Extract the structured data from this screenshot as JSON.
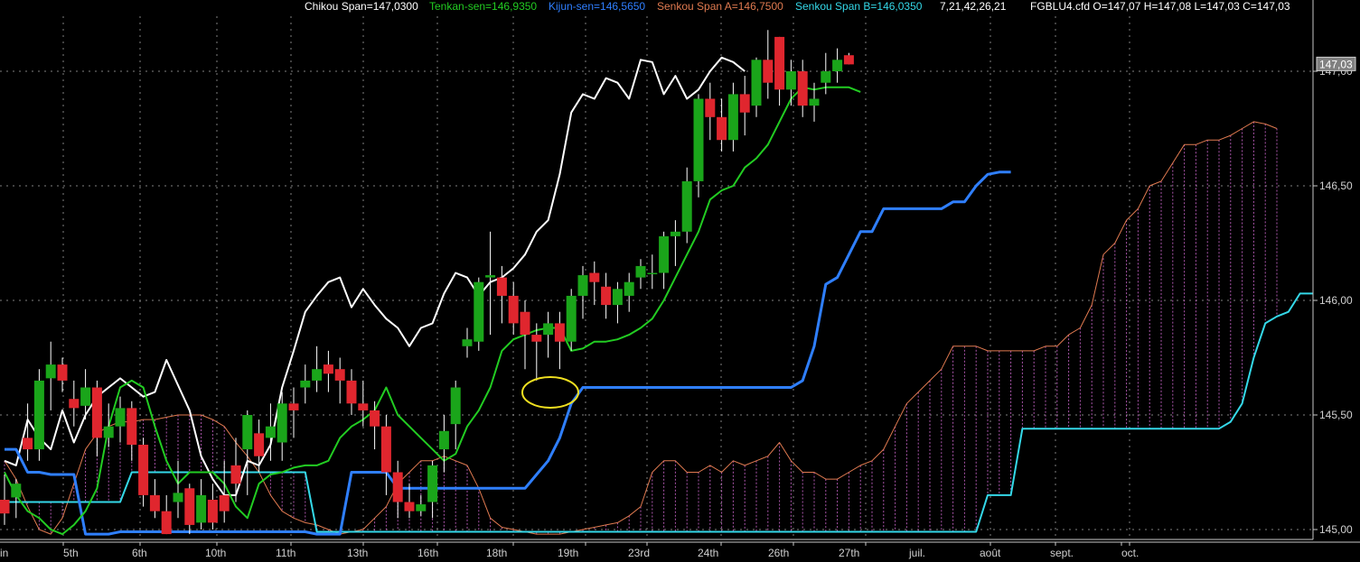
{
  "header": {
    "chikou": "Chikou Span=147,0300",
    "tenkan": "Tenkan-sen=146,9350",
    "kijun": "Kijun-sen=146,5650",
    "senkou_a": "Senkou Span A=146,7500",
    "senkou_b": "Senkou Span B=146,0350",
    "params": "7,21,42,26,21",
    "ohlc": "FGBLU4.cfd O=147,07 H=147,08 L=147,03 C=147,03"
  },
  "colors": {
    "background": "#000000",
    "grid": "#808080",
    "up_candle": "#1aa51a",
    "down_candle": "#e0262e",
    "wick": "#ffffff",
    "chikou": "#ffffff",
    "tenkan": "#22cc22",
    "kijun": "#2f7fff",
    "senkou_a": "#e07a50",
    "senkou_b": "#34d8e8",
    "cloud_fill": "#cc66cc",
    "highlight_ellipse": "#f0e020"
  },
  "current_price_label": "147,03",
  "chart_data": {
    "type": "line",
    "subtype": "ichimoku candlestick",
    "yticks": [
      "145,00",
      "145,50",
      "146,00",
      "146,50",
      "147,00"
    ],
    "ylim": [
      144.98,
      147.2
    ],
    "xticks": [
      "in",
      "5th",
      "6th",
      "10th",
      "11th",
      "13th",
      "16th",
      "18th",
      "19th",
      "23rd",
      "24th",
      "26th",
      "27th",
      "juil.",
      "août",
      "sept.",
      "oct."
    ],
    "grid": true,
    "annotation": "ellipse at Kijun-sen near 145,62",
    "candles": [
      [
        145.13,
        145.07,
        145.24,
        145.02
      ],
      [
        145.14,
        145.2,
        145.22,
        145.05
      ],
      [
        145.4,
        145.35,
        145.55,
        145.3
      ],
      [
        145.35,
        145.65,
        145.7,
        145.3
      ],
      [
        145.66,
        145.72,
        145.82,
        145.52
      ],
      [
        145.72,
        145.65,
        145.75,
        145.6
      ],
      [
        145.57,
        145.53,
        145.65,
        145.45
      ],
      [
        145.54,
        145.62,
        145.7,
        145.48
      ],
      [
        145.62,
        145.4,
        145.65,
        145.32
      ],
      [
        145.4,
        145.45,
        145.55,
        145.36
      ],
      [
        145.45,
        145.53,
        145.58,
        145.38
      ],
      [
        145.53,
        145.37,
        145.56,
        145.3
      ],
      [
        145.37,
        145.15,
        145.4,
        145.1
      ],
      [
        145.15,
        145.08,
        145.22,
        145.05
      ],
      [
        145.08,
        144.98,
        145.15,
        144.98
      ],
      [
        145.12,
        145.16,
        145.3,
        145.05
      ],
      [
        145.18,
        145.02,
        145.2,
        144.98
      ],
      [
        145.03,
        145.15,
        145.22,
        145.0
      ],
      [
        145.13,
        145.03,
        145.2,
        145.0
      ],
      [
        145.15,
        145.08,
        145.3,
        145.03
      ],
      [
        145.28,
        145.2,
        145.4,
        145.12
      ],
      [
        145.35,
        145.5,
        145.52,
        145.15
      ],
      [
        145.42,
        145.32,
        145.48,
        145.25
      ],
      [
        145.4,
        145.45,
        145.55,
        145.3
      ],
      [
        145.38,
        145.55,
        145.6,
        145.3
      ],
      [
        145.55,
        145.52,
        145.62,
        145.4
      ],
      [
        145.62,
        145.65,
        145.72,
        145.55
      ],
      [
        145.65,
        145.7,
        145.8,
        145.6
      ],
      [
        145.72,
        145.68,
        145.78,
        145.6
      ],
      [
        145.7,
        145.65,
        145.75,
        145.55
      ],
      [
        145.65,
        145.55,
        145.7,
        145.5
      ],
      [
        145.55,
        145.52,
        145.65,
        145.45
      ],
      [
        145.52,
        145.45,
        145.56,
        145.35
      ],
      [
        145.45,
        145.25,
        145.5,
        145.15
      ],
      [
        145.25,
        145.12,
        145.3,
        145.05
      ],
      [
        145.12,
        145.08,
        145.2,
        145.05
      ],
      [
        145.08,
        145.11,
        145.15,
        145.06
      ],
      [
        145.12,
        145.28,
        145.3,
        145.05
      ],
      [
        145.35,
        145.43,
        145.5,
        145.25
      ],
      [
        145.46,
        145.62,
        145.65,
        145.35
      ],
      [
        145.8,
        145.83,
        145.88,
        145.75
      ],
      [
        145.82,
        146.08,
        146.1,
        145.78
      ],
      [
        146.1,
        146.11,
        146.3,
        145.85
      ],
      [
        146.1,
        146.02,
        146.15,
        145.9
      ],
      [
        146.02,
        145.9,
        146.08,
        145.85
      ],
      [
        145.95,
        145.85,
        146.0,
        145.7
      ],
      [
        145.85,
        145.82,
        145.9,
        145.65
      ],
      [
        145.85,
        145.9,
        145.95,
        145.75
      ],
      [
        145.9,
        145.82,
        145.95,
        145.7
      ],
      [
        145.82,
        146.02,
        146.05,
        145.78
      ],
      [
        146.02,
        146.11,
        146.15,
        145.92
      ],
      [
        146.12,
        146.08,
        146.17,
        145.98
      ],
      [
        146.06,
        145.98,
        146.12,
        145.92
      ],
      [
        145.98,
        146.05,
        146.08,
        145.9
      ],
      [
        146.02,
        146.08,
        146.12,
        145.95
      ],
      [
        146.1,
        146.15,
        146.18,
        146.05
      ],
      [
        146.12,
        146.12,
        146.2,
        146.05
      ],
      [
        146.12,
        146.28,
        146.3,
        146.05
      ],
      [
        146.28,
        146.3,
        146.35,
        146.15
      ],
      [
        146.3,
        146.52,
        146.58,
        146.25
      ],
      [
        146.52,
        146.88,
        146.9,
        146.45
      ],
      [
        146.88,
        146.8,
        146.95,
        146.7
      ],
      [
        146.8,
        146.7,
        146.88,
        146.65
      ],
      [
        146.7,
        146.9,
        146.95,
        146.65
      ],
      [
        146.9,
        146.82,
        146.98,
        146.72
      ],
      [
        146.85,
        147.05,
        147.06,
        146.8
      ],
      [
        147.05,
        146.95,
        147.18,
        146.88
      ],
      [
        147.15,
        146.92,
        147.15,
        146.85
      ],
      [
        146.92,
        147.0,
        147.05,
        146.85
      ],
      [
        147.0,
        146.85,
        147.05,
        146.8
      ],
      [
        146.85,
        146.88,
        146.95,
        146.78
      ],
      [
        146.95,
        147.0,
        147.08,
        146.9
      ],
      [
        147.0,
        147.05,
        147.1,
        146.95
      ],
      [
        147.07,
        147.03,
        147.08,
        147.03
      ]
    ],
    "series": [
      {
        "name": "Chikou Span",
        "x0": 0,
        "values": [
          145.3,
          145.28,
          145.48,
          145.4,
          145.35,
          145.52,
          145.38,
          145.5,
          145.58,
          145.62,
          145.66,
          145.62,
          145.58,
          145.6,
          145.74,
          145.63,
          145.52,
          145.32,
          145.22,
          145.15,
          145.15,
          145.3,
          145.28,
          145.37,
          145.62,
          145.78,
          145.95,
          146.02,
          146.08,
          146.1,
          145.97,
          146.05,
          145.98,
          145.92,
          145.88,
          145.8,
          145.88,
          145.9,
          146.03,
          146.12,
          146.1,
          146.02,
          146.08,
          146.1,
          146.14,
          146.2,
          146.3,
          146.35,
          146.55,
          146.82,
          146.9,
          146.88,
          146.97,
          146.95,
          146.88,
          147.05,
          147.04,
          146.9,
          146.98,
          146.88,
          146.92,
          147.0,
          147.06,
          147.04,
          147.0
        ]
      },
      {
        "name": "Tenkan-sen",
        "x0": 0,
        "values": [
          145.25,
          145.15,
          145.08,
          145.05,
          145.0,
          144.98,
          145.02,
          145.08,
          145.18,
          145.45,
          145.62,
          145.65,
          145.62,
          145.45,
          145.3,
          145.2,
          145.25,
          145.25,
          145.25,
          145.2,
          145.1,
          145.05,
          145.2,
          145.24,
          145.25,
          145.27,
          145.28,
          145.28,
          145.3,
          145.4,
          145.45,
          145.48,
          145.52,
          145.62,
          145.5,
          145.45,
          145.4,
          145.35,
          145.3,
          145.33,
          145.45,
          145.52,
          145.62,
          145.78,
          145.83,
          145.85,
          145.87,
          145.88,
          145.88,
          145.78,
          145.79,
          145.82,
          145.82,
          145.83,
          145.85,
          145.88,
          145.92,
          146.0,
          146.1,
          146.2,
          146.3,
          146.44,
          146.48,
          146.5,
          146.58,
          146.62,
          146.68,
          146.78,
          146.88,
          146.93,
          146.92,
          146.93,
          146.93,
          146.93,
          146.91
        ]
      },
      {
        "name": "Kijun-sen",
        "x0": 0,
        "values": [
          145.35,
          145.35,
          145.25,
          145.25,
          145.24,
          145.24,
          145.24,
          144.98,
          144.98,
          144.98,
          144.99,
          144.99,
          144.99,
          144.99,
          144.99,
          144.99,
          144.99,
          144.99,
          144.99,
          144.99,
          144.99,
          144.99,
          144.99,
          144.99,
          144.99,
          144.99,
          144.99,
          144.98,
          144.98,
          144.98,
          145.25,
          145.25,
          145.25,
          145.25,
          145.18,
          145.18,
          145.18,
          145.18,
          145.18,
          145.18,
          145.18,
          145.18,
          145.18,
          145.18,
          145.18,
          145.18,
          145.24,
          145.3,
          145.4,
          145.55,
          145.62,
          145.62,
          145.62,
          145.62,
          145.62,
          145.62,
          145.62,
          145.62,
          145.62,
          145.62,
          145.62,
          145.62,
          145.62,
          145.62,
          145.62,
          145.62,
          145.62,
          145.62,
          145.62,
          145.65,
          145.8,
          146.07,
          146.1,
          146.2,
          146.3,
          146.3,
          146.4,
          146.4,
          146.4,
          146.4,
          146.4,
          146.4,
          146.43,
          146.43,
          146.5,
          146.55,
          146.56,
          146.56
        ]
      },
      {
        "name": "Senkou Span A",
        "x0": 0,
        "values": [
          145.3,
          145.22,
          145.1,
          145.0,
          144.98,
          145.05,
          145.2,
          145.35,
          145.42,
          145.45,
          145.47,
          145.47,
          145.48,
          145.48,
          145.49,
          145.5,
          145.5,
          145.5,
          145.48,
          145.45,
          145.38,
          145.32,
          145.25,
          145.15,
          145.08,
          145.05,
          145.03,
          145.02,
          145.0,
          144.98,
          144.99,
          145.0,
          145.05,
          145.1,
          145.2,
          145.25,
          145.3,
          145.3,
          145.32,
          145.3,
          145.28,
          145.18,
          145.05,
          145.01,
          145.0,
          144.99,
          144.98,
          144.98,
          144.98,
          144.99,
          145.0,
          145.01,
          145.02,
          145.03,
          145.06,
          145.1,
          145.25,
          145.3,
          145.3,
          145.25,
          145.25,
          145.28,
          145.25,
          145.3,
          145.28,
          145.3,
          145.32,
          145.38,
          145.3,
          145.25,
          145.25,
          145.22,
          145.22,
          145.25,
          145.28,
          145.3,
          145.35,
          145.45,
          145.55,
          145.6,
          145.65,
          145.7,
          145.8,
          145.8,
          145.8,
          145.78,
          145.78,
          145.78,
          145.78,
          145.78,
          145.8,
          145.8,
          145.85,
          145.88,
          145.98,
          146.2,
          146.25,
          146.35,
          146.4,
          146.5,
          146.52,
          146.6,
          146.68,
          146.68,
          146.7,
          146.7,
          146.72,
          146.75,
          146.78,
          146.77,
          146.75
        ]
      },
      {
        "name": "Senkou Span B",
        "x0": 0,
        "values": [
          145.12,
          145.12,
          145.12,
          145.12,
          145.12,
          145.12,
          145.12,
          145.12,
          145.12,
          145.12,
          145.12,
          145.25,
          145.25,
          145.25,
          145.25,
          145.25,
          145.25,
          145.25,
          145.25,
          145.25,
          145.25,
          145.25,
          145.25,
          145.25,
          145.25,
          145.25,
          145.25,
          144.99,
          144.99,
          144.99,
          144.99,
          144.99,
          144.99,
          144.99,
          144.99,
          144.99,
          144.99,
          144.99,
          144.99,
          144.99,
          144.99,
          144.99,
          144.99,
          144.99,
          144.99,
          144.99,
          144.99,
          144.99,
          144.99,
          144.99,
          144.99,
          144.99,
          144.99,
          144.99,
          144.99,
          144.99,
          144.99,
          144.99,
          144.99,
          144.99,
          144.99,
          144.99,
          144.99,
          144.99,
          144.99,
          144.99,
          144.99,
          144.99,
          144.99,
          144.99,
          144.99,
          144.99,
          144.99,
          144.99,
          144.99,
          144.99,
          144.99,
          144.99,
          144.99,
          144.99,
          144.99,
          144.99,
          144.99,
          144.99,
          144.99,
          145.15,
          145.15,
          145.15,
          145.44,
          145.44,
          145.44,
          145.44,
          145.44,
          145.44,
          145.44,
          145.44,
          145.44,
          145.44,
          145.44,
          145.44,
          145.44,
          145.44,
          145.44,
          145.44,
          145.44,
          145.44,
          145.47,
          145.55,
          145.75,
          145.9,
          145.93,
          145.95,
          146.03,
          146.03,
          146.03,
          146.03,
          146.03,
          146.03,
          146.03,
          146.03,
          146.03,
          146.03,
          146.03,
          146.03,
          146.03,
          146.03,
          146.03,
          146.03,
          146.03,
          146.03
        ]
      }
    ]
  }
}
